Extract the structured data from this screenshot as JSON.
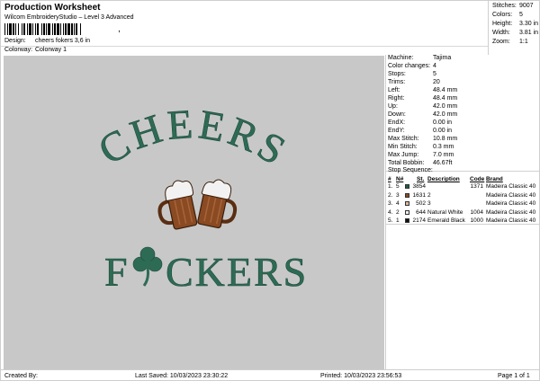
{
  "header": {
    "title": "Production Worksheet",
    "subtitle": "Wilcom EmbroideryStudio – Level 3 Advanced",
    "barcode_suffix": ",",
    "design_label": "Design:",
    "design_value": "cheers fokers 3,6 in",
    "colorway_label": "Colorway:",
    "colorway_value": "Colorway 1"
  },
  "stats": [
    {
      "label": "Stitches:",
      "value": "9007"
    },
    {
      "label": "Colors:",
      "value": "5"
    },
    {
      "label": "Height:",
      "value": "3.30 in"
    },
    {
      "label": "Width:",
      "value": "3.81 in"
    },
    {
      "label": "Zoom:",
      "value": "1:1"
    }
  ],
  "design": {
    "line1": "CHEERS",
    "line2_left": "F",
    "line2_right": "CKERS"
  },
  "properties": [
    {
      "label": "Machine:",
      "value": "Tajima"
    },
    {
      "label": "Color changes:",
      "value": "4"
    },
    {
      "label": "Stops:",
      "value": "5"
    },
    {
      "label": "Trims:",
      "value": "20"
    },
    {
      "label": "Left:",
      "value": "48.4 mm"
    },
    {
      "label": "Right:",
      "value": "48.4 mm"
    },
    {
      "label": "Up:",
      "value": "42.0 mm"
    },
    {
      "label": "Down:",
      "value": "42.0 mm"
    },
    {
      "label": "EndX:",
      "value": "0.00 in"
    },
    {
      "label": "EndY:",
      "value": "0.00 in"
    },
    {
      "label": "Max Stitch:",
      "value": "10.8 mm"
    },
    {
      "label": "Min Stitch:",
      "value": "0.3 mm"
    },
    {
      "label": "Max Jump:",
      "value": "7.0 mm"
    },
    {
      "label": "Total Bobbin:",
      "value": "46.67ft"
    }
  ],
  "stop_sequence": {
    "title": "Stop Sequence:",
    "headers": {
      "num": "#",
      "n": "N#",
      "st": "St.",
      "desc": "Description",
      "code": "Code",
      "brand": "Brand"
    },
    "rows": [
      {
        "num": "1.",
        "n": "5",
        "color": "#1e5c4a",
        "st": "3854",
        "desc": "",
        "code": "1371",
        "brand": "Madeira Classic 40"
      },
      {
        "num": "2.",
        "n": "3",
        "color": "#8a4a22",
        "st": "1631",
        "desc": "2",
        "code": "",
        "brand": "Madeira Classic 40"
      },
      {
        "num": "3.",
        "n": "4",
        "color": "#d9b79c",
        "st": "502",
        "desc": "3",
        "code": "",
        "brand": "Madeira Classic 40"
      },
      {
        "num": "4.",
        "n": "2",
        "color": "#eeeeee",
        "st": "644",
        "desc": "Natural White",
        "code": "1004",
        "brand": "Madeira Classic 40"
      },
      {
        "num": "5.",
        "n": "1",
        "color": "#111111",
        "st": "2174",
        "desc": "Emerald Black",
        "code": "1000",
        "brand": "Madeira Classic 40"
      }
    ]
  },
  "footer": {
    "created_by": "Created By:",
    "last_saved": "Last Saved: 10/03/2023 23:30:22",
    "printed": "Printed: 10/03/2023 23:56:53",
    "page": "Page 1 of 1"
  },
  "colors": {
    "canvas": "#c8c8c8",
    "thread_green": "#2e6b55",
    "beer": "#8a4a22",
    "foam": "#f2f2f2"
  }
}
